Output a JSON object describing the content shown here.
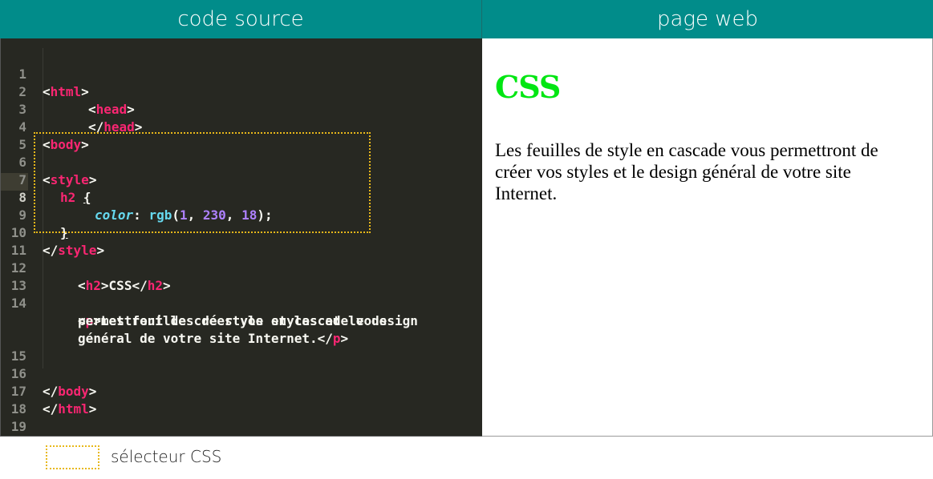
{
  "headers": {
    "left": "code source",
    "right": "page web"
  },
  "line_numbers": [
    "1",
    "2",
    "3",
    "4",
    "5",
    "6",
    "7",
    "8",
    "9",
    "10",
    "11",
    "12",
    "13",
    "14",
    "15",
    "16",
    "17",
    "18",
    "19"
  ],
  "code": {
    "l1": {
      "open": "<",
      "tag": "html",
      "close": ">"
    },
    "l2": {
      "open": "<",
      "tag": "head",
      "close": ">"
    },
    "l3": {
      "open": "</",
      "tag": "head",
      "close": ">"
    },
    "l4": {
      "open": "<",
      "tag": "body",
      "close": ">"
    },
    "l6": {
      "open": "<",
      "tag": "style",
      "close": ">"
    },
    "l7": {
      "selector": "h2",
      "brace": "{"
    },
    "l8": {
      "prop": "color",
      "colon": ": ",
      "fn": "rgb",
      "paren_open": "(",
      "n1": "1",
      "c1": ", ",
      "n2": "230",
      "c2": ", ",
      "n3": "18",
      "paren_close": ");"
    },
    "l9": {
      "brace": "}"
    },
    "l10": {
      "open": "</",
      "tag": "style",
      "close": ">"
    },
    "l12": {
      "open1": "<",
      "tag1": "h2",
      "close1": ">",
      "text": "CSS",
      "open2": "</",
      "tag2": "h2",
      "close2": ">"
    },
    "l14": {
      "open": "<",
      "tag": "p",
      "close": ">",
      "text": "Les feuilles de style en cascade vous"
    },
    "l14b": {
      "text": "permettront de créer vos styles et le design"
    },
    "l14c": {
      "text": "général de votre site Internet.",
      "open": "</",
      "tag": "p",
      "close": ">"
    },
    "l16": {
      "open": "</",
      "tag": "body",
      "close": ">"
    },
    "l17": {
      "open": "</",
      "tag": "html",
      "close": ">"
    }
  },
  "webpage": {
    "h2": "CSS",
    "p": "Les feuilles de style en cascade vous permettront de créer vos styles et le design général de votre site Internet."
  },
  "legend": {
    "label": "sélecteur CSS"
  },
  "colors": {
    "header": "#018c8a",
    "editor_bg": "#272822",
    "tag": "#f92672",
    "property": "#66d9ef",
    "number": "#ae81ff",
    "h2_color": "#01e612",
    "selector_outline": "#e8b81a"
  }
}
